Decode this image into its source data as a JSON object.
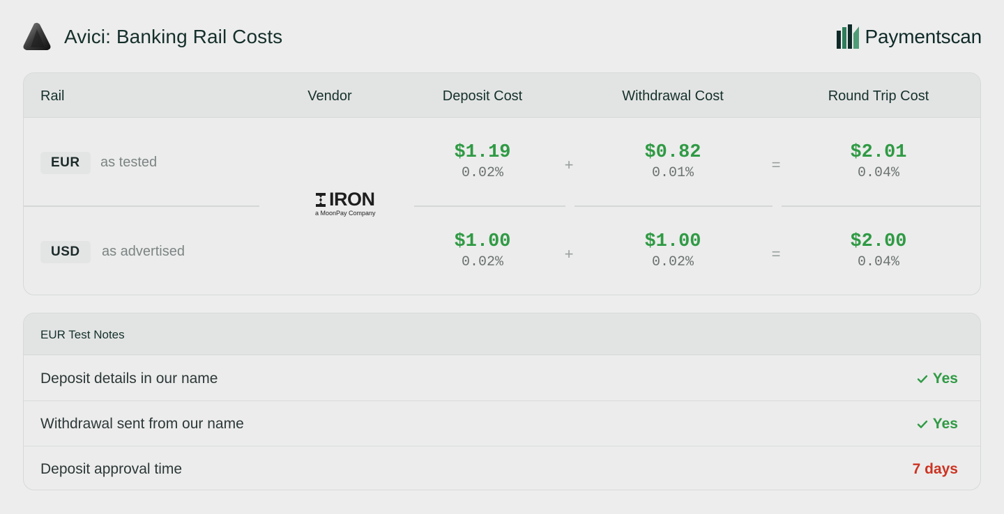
{
  "header": {
    "title": "Avici: Banking Rail Costs",
    "brand_name": "Paymentscan"
  },
  "table": {
    "columns": [
      "Rail",
      "Vendor",
      "Deposit Cost",
      "Withdrawal Cost",
      "Round Trip Cost"
    ],
    "vendor": {
      "name": "IRON",
      "tagline": "a MoonPay Company"
    },
    "operators": {
      "plus": "+",
      "equals": "="
    },
    "rows": [
      {
        "rail": "EUR",
        "note": "as tested",
        "deposit": {
          "amount": "$1.19",
          "pct": "0.02%"
        },
        "withdrawal": {
          "amount": "$0.82",
          "pct": "0.01%"
        },
        "round_trip": {
          "amount": "$2.01",
          "pct": "0.04%"
        }
      },
      {
        "rail": "USD",
        "note": "as advertised",
        "deposit": {
          "amount": "$1.00",
          "pct": "0.02%"
        },
        "withdrawal": {
          "amount": "$1.00",
          "pct": "0.02%"
        },
        "round_trip": {
          "amount": "$2.00",
          "pct": "0.04%"
        }
      }
    ]
  },
  "notes": {
    "title": "EUR Test Notes",
    "rows": [
      {
        "label": "Deposit details in our name",
        "value": "Yes",
        "status": "ok"
      },
      {
        "label": "Withdrawal sent from our name",
        "value": "Yes",
        "status": "ok"
      },
      {
        "label": "Deposit approval time",
        "value": "7 days",
        "status": "bad"
      }
    ]
  },
  "colors": {
    "positive": "#2f9a44",
    "negative": "#cc3322",
    "brand_dark": "#0f2a28",
    "brand_green": "#2e7d5b"
  }
}
